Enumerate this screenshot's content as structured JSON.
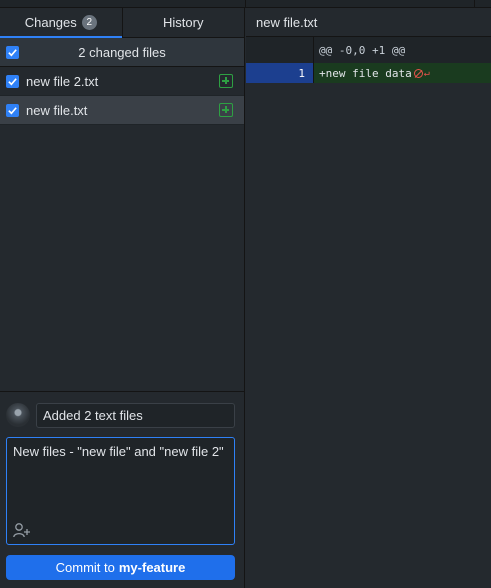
{
  "tabs": {
    "changes_label": "Changes",
    "changes_count": "2",
    "history_label": "History"
  },
  "changes": {
    "summary": "2 changed files",
    "files": [
      {
        "name": "new file 2.txt",
        "checked": true,
        "status_icon": "added-icon"
      },
      {
        "name": "new file.txt",
        "checked": true,
        "status_icon": "added-icon",
        "selected": true
      }
    ]
  },
  "commit": {
    "summary_value": "Added 2 text files",
    "description_value": "New files - \"new file\" and \"new file 2\"",
    "button_prefix": "Commit to",
    "branch": "my-feature"
  },
  "diff": {
    "file_title": "new file.txt",
    "hunk_header": "@@ -0,0 +1 @@",
    "lines": [
      {
        "number": "1",
        "text": "+new file data"
      }
    ]
  },
  "colors": {
    "accent": "#2f81f7",
    "added": "#2ea043",
    "no_newline": "#e5534b"
  }
}
